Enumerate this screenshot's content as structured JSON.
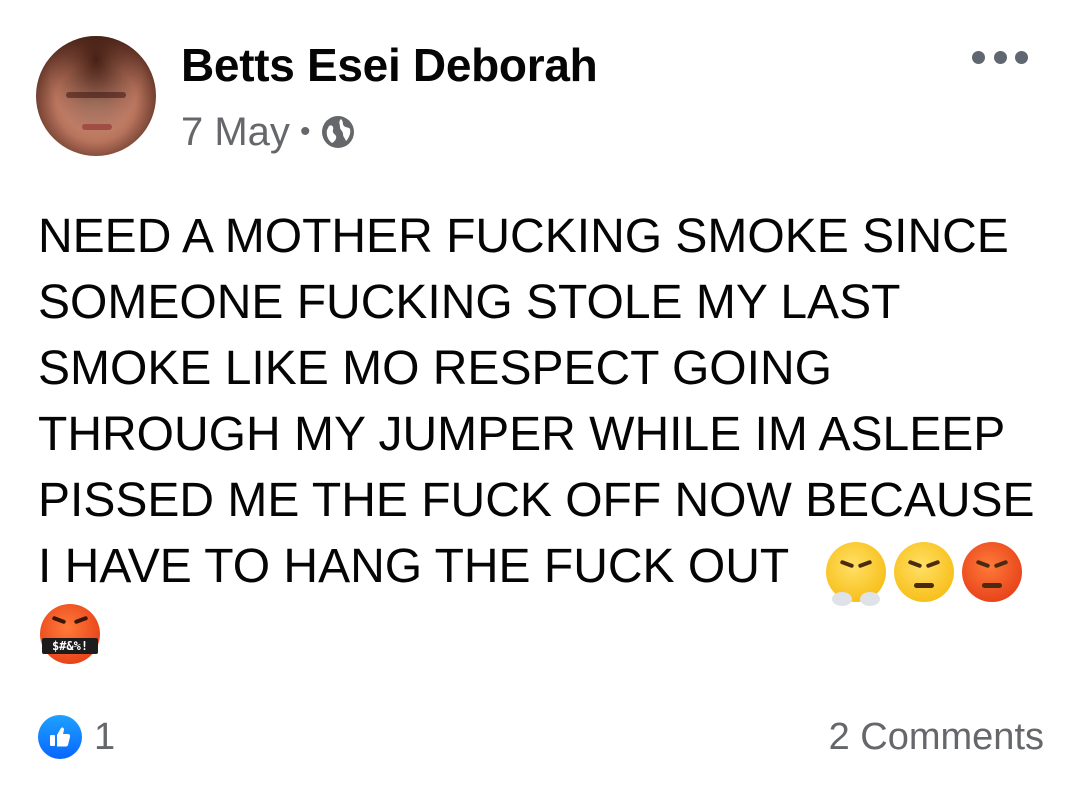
{
  "post": {
    "author": "Betts Esei Deborah",
    "date": "7 May",
    "separator": "•",
    "privacy_icon": "globe-icon",
    "menu_icon": "more-options-icon",
    "body_text": "NEED A MOTHER FUCKING SMOKE SINCE\nSOMEONE FUCKING STOLE MY LAST\nSMOKE LIKE MO RESPECT GOING\nTHROUGH MY JUMPER WHILE IM ASLEEP\nPISSED ME THE FUCK OFF NOW BECAUSE\nI HAVE TO HANG THE FUCK OUT",
    "emojis": [
      "face-with-steam-from-nose",
      "angry-face",
      "pouting-face",
      "face-with-symbols-on-mouth"
    ],
    "cursing_symbols": "$#&%!"
  },
  "footer": {
    "reaction_icon": "like-icon",
    "reaction_count": "1",
    "comments_label": "2 Comments"
  },
  "colors": {
    "text": "#050505",
    "secondary_text": "#65676b",
    "like_blue": "#0866ff"
  }
}
